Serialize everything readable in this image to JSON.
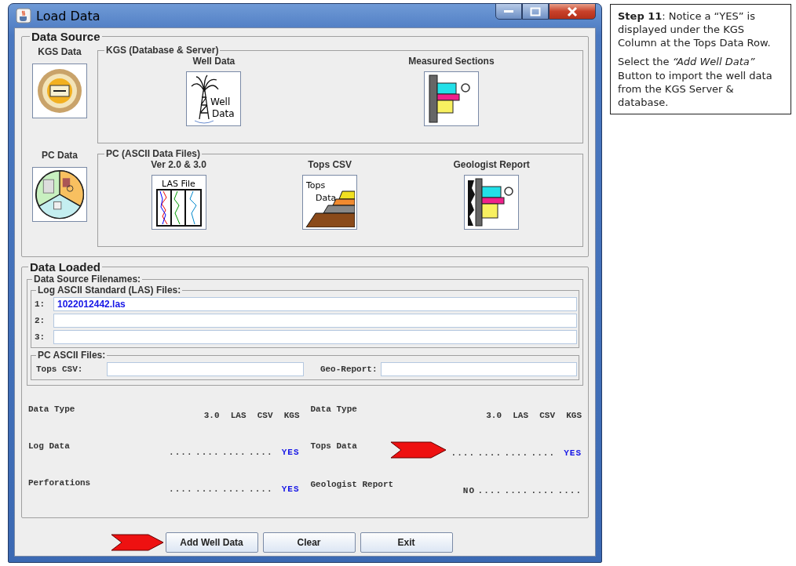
{
  "window": {
    "title": "Load Data"
  },
  "data_source": {
    "title": "Data Source",
    "groups": [
      {
        "side_label": "KGS Data",
        "title": "KGS (Database & Server)",
        "items": [
          {
            "label": "Well Data",
            "kind": "well",
            "icon_text": [
              "Well",
              "Data"
            ]
          },
          {
            "label": "Measured Sections",
            "kind": "section"
          }
        ]
      },
      {
        "side_label": "PC Data",
        "title": "PC (ASCII Data Files)",
        "items": [
          {
            "label": "Ver 2.0 & 3.0",
            "kind": "las",
            "icon_text": [
              "LAS File"
            ]
          },
          {
            "label": "Tops CSV",
            "kind": "tops",
            "icon_text": [
              "Tops",
              "Data"
            ]
          },
          {
            "label": "Geologist Report",
            "kind": "report"
          }
        ]
      }
    ]
  },
  "data_loaded": {
    "title": "Data Loaded",
    "filenames_title": "Data Source Filenames:",
    "las": {
      "title": "Log ASCII Standard (LAS) Files:",
      "fields": [
        {
          "label": "1:",
          "value": "1022012442.las"
        },
        {
          "label": "2:"
        },
        {
          "label": "3:"
        }
      ]
    },
    "pc": {
      "title": "PC ASCII Files:",
      "fields": [
        {
          "label": "Tops CSV:"
        },
        {
          "label": "Geo-Report:"
        }
      ]
    },
    "status": [
      {
        "header": "Data Type",
        "columns": [
          "",
          "3.0",
          "LAS",
          "CSV",
          "KGS"
        ],
        "rows": [
          {
            "label": "Log Data",
            "pointer": false,
            "cells": [
              {
                "text": "....",
                "found": false
              },
              {
                "text": "....",
                "found": false
              },
              {
                "text": "....",
                "found": false
              },
              {
                "text": "....",
                "found": false
              },
              {
                "text": "YES",
                "found": true
              }
            ]
          },
          {
            "label": "Perforations",
            "pointer": false,
            "cells": [
              {
                "text": "....",
                "found": false
              },
              {
                "text": "....",
                "found": false
              },
              {
                "text": "....",
                "found": false
              },
              {
                "text": "....",
                "found": false
              },
              {
                "text": "YES",
                "found": true
              }
            ]
          }
        ]
      },
      {
        "header": "Data Type",
        "columns": [
          "",
          "3.0",
          "LAS",
          "CSV",
          "KGS"
        ],
        "rows": [
          {
            "label": "Tops Data",
            "pointer": true,
            "cells": [
              {
                "text": "....",
                "found": false
              },
              {
                "text": "....",
                "found": false
              },
              {
                "text": "....",
                "found": false
              },
              {
                "text": "....",
                "found": false
              },
              {
                "text": "YES",
                "found": true
              }
            ]
          },
          {
            "label": "Geologist Report",
            "pointer": false,
            "cells": [
              {
                "text": "NO",
                "found": false
              },
              {
                "text": "....",
                "found": false
              },
              {
                "text": "....",
                "found": false
              },
              {
                "text": "....",
                "found": false
              },
              {
                "text": "....",
                "found": false
              }
            ]
          }
        ]
      }
    ]
  },
  "buttons": [
    {
      "label": "Add Well Data",
      "pointer": true
    },
    {
      "label": "Clear",
      "pointer": false
    },
    {
      "label": "Exit",
      "pointer": false
    }
  ],
  "callout": {
    "paragraphs": [
      "**Step 11**: Notice a “YES” is displayed under the KGS Column at the Tops Data Row.",
      "Select the *“Add Well Data”* Button to import the well data  from the KGS Server & database."
    ]
  }
}
